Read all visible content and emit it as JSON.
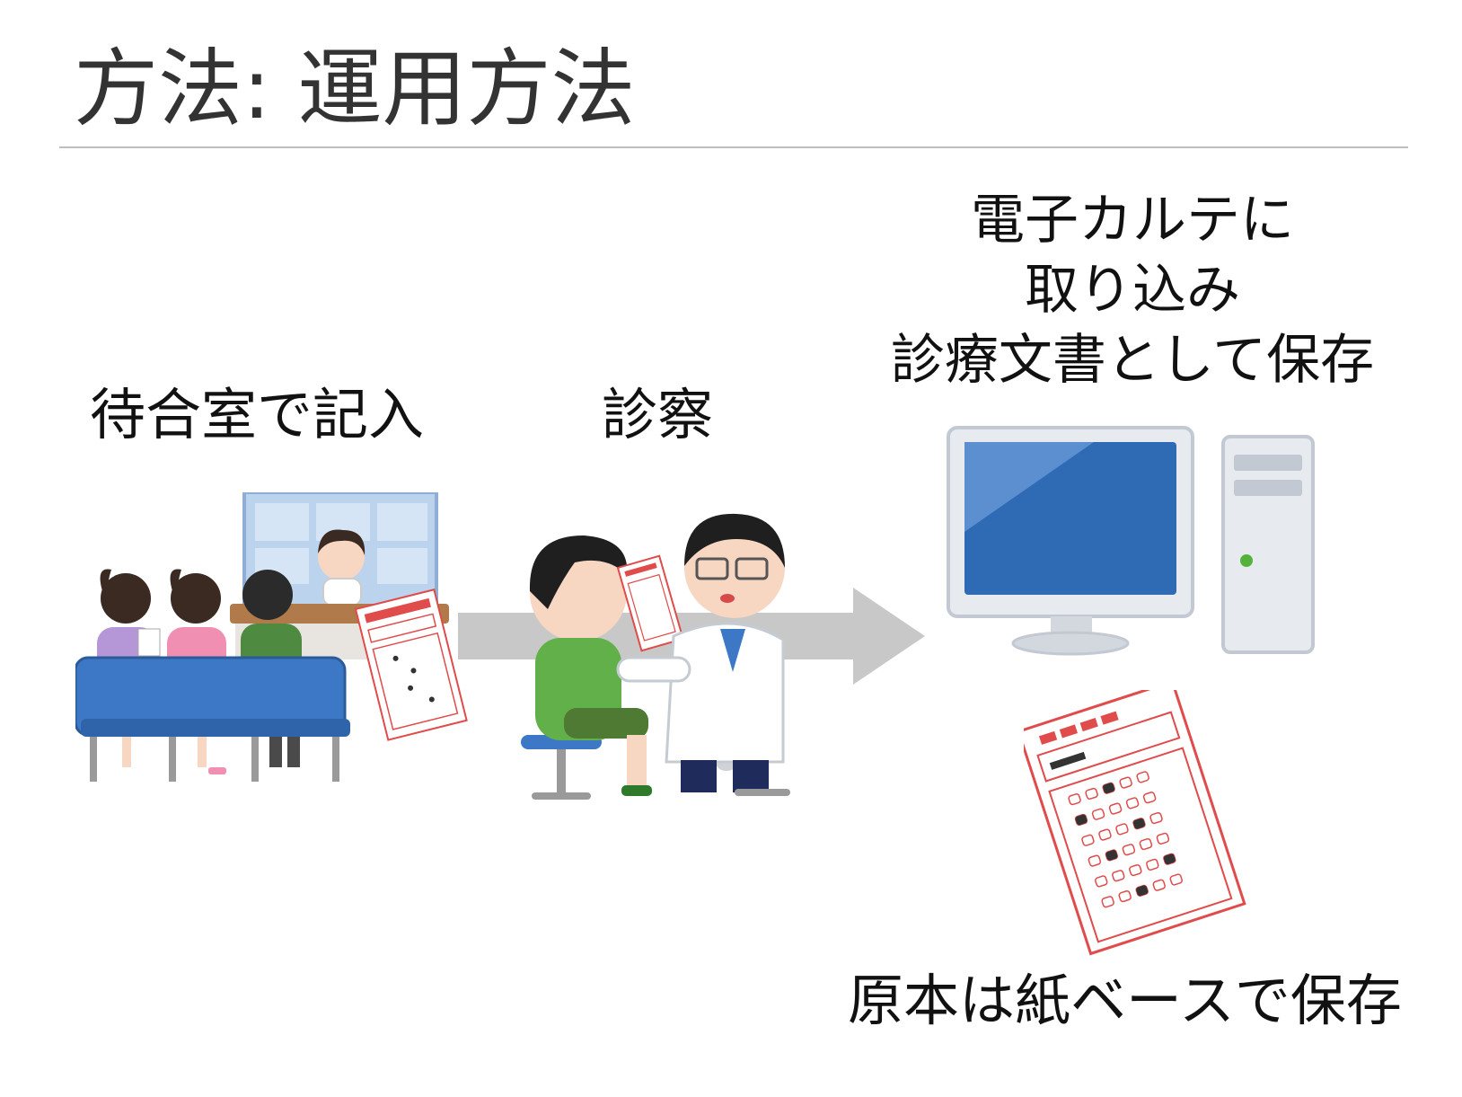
{
  "slide": {
    "title": "方法: 運用方法"
  },
  "steps": [
    {
      "caption": "待合室で記入"
    },
    {
      "caption": "診察"
    },
    {
      "caption_lines": [
        "電子カルテに",
        "取り込み",
        "診療文書として保存"
      ]
    }
  ],
  "paper_note": "原本は紙ベースで保存",
  "colors": {
    "title": "#333333",
    "rule": "#bdbdbd",
    "arrow": "#c8c8c8",
    "bench": "#3d78c6",
    "monitor_screen": "#2f6bb5",
    "sheet_red": "#e04b4b"
  },
  "icons": {
    "waiting_room": "reception-waiting-room-illustration",
    "exam": "doctor-patient-illustration",
    "computer": "desktop-computer-illustration",
    "sheet": "mark-sheet-form-illustration"
  }
}
